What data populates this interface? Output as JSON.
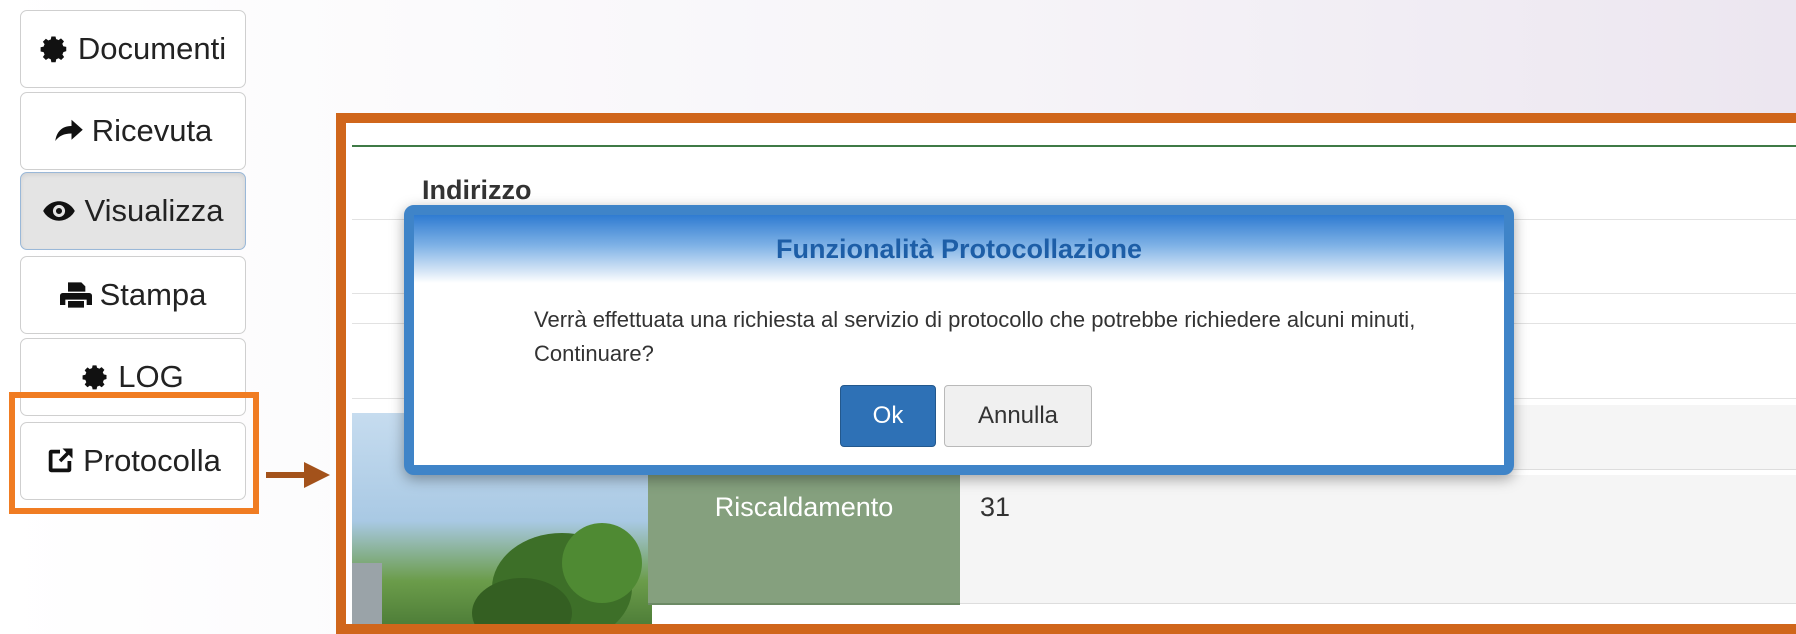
{
  "sidebar": {
    "items": [
      {
        "label": "Documenti",
        "icon": "gear-icon"
      },
      {
        "label": "Ricevuta",
        "icon": "share-arrow-icon"
      },
      {
        "label": "Visualizza",
        "icon": "eye-icon"
      },
      {
        "label": "Stampa",
        "icon": "printer-icon"
      },
      {
        "label": "LOG",
        "icon": "gear-icon"
      },
      {
        "label": "Protocolla",
        "icon": "external-link-icon"
      }
    ]
  },
  "panel": {
    "section_header": "Indirizzo",
    "rows": [
      {
        "label": "Riscaldamento",
        "value": "31"
      }
    ]
  },
  "dialog": {
    "title": "Funzionalità Protocollazione",
    "message": "Verrà effettuata una richiesta al servizio di protocollo che potrebbe richiedere alcuni minuti, Continuare?",
    "ok_label": "Ok",
    "cancel_label": "Annulla"
  },
  "colors": {
    "highlight": "#f07c22",
    "panel_border": "#d0661b",
    "dialog_border": "#3f84c8",
    "primary_button": "#2e71b6",
    "label_cell": "#85a07e"
  }
}
